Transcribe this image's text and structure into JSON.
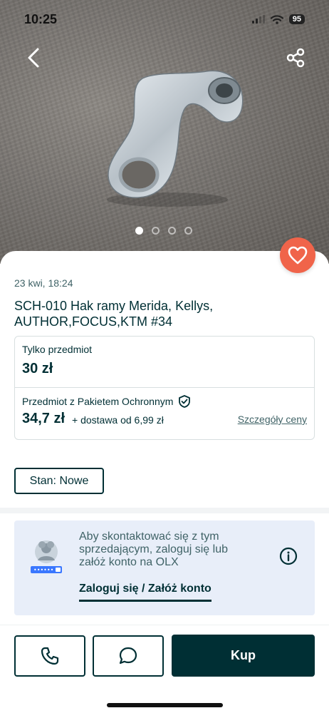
{
  "status_bar": {
    "time": "10:25",
    "battery": "95"
  },
  "gallery": {
    "image_count": 4,
    "active_index": 0
  },
  "listing": {
    "date": "23 kwi, 18:24",
    "title": "SCH-010 Hak ramy Merida, Kellys, AUTHOR,FOCUS,KTM #34"
  },
  "pricing": {
    "item_only_label": "Tylko przedmiot",
    "item_only_price": "30 zł",
    "protected_label": "Przedmiot z Pakietem Ochronnym",
    "protected_price": "34,7 zł",
    "delivery": "+ dostawa od 6,99 zł",
    "details_link": "Szczegóły ceny"
  },
  "condition": {
    "label": "Stan: Nowe"
  },
  "login_prompt": {
    "text": "Aby skontaktować się z tym sprzedającym, zaloguj się lub załóż konto na OLX",
    "link": "Zaloguj się / Załóż konto"
  },
  "actions": {
    "buy_label": "Kup"
  },
  "icons": {
    "back": "chevron-left-icon",
    "share": "share-icon",
    "favorite": "heart-icon",
    "shield": "shield-check-icon",
    "info": "info-icon",
    "phone": "phone-icon",
    "chat": "chat-bubble-icon"
  },
  "colors": {
    "primary": "#002f34",
    "favorite": "#f0644a",
    "login_card_bg": "#e8eef9"
  }
}
